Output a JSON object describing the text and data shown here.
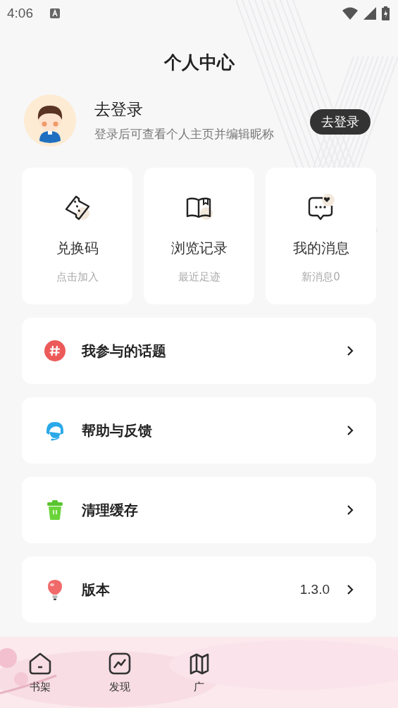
{
  "status_bar": {
    "time": "4:06"
  },
  "title": "个人中心",
  "profile": {
    "name": "去登录",
    "hint": "登录后可查看个人主页并编辑昵称",
    "login_button": "去登录"
  },
  "shortcuts": [
    {
      "kind": "ticket",
      "label": "兑换码",
      "caption": "点击加入"
    },
    {
      "kind": "book",
      "label": "浏览记录",
      "caption": "最近足迹"
    },
    {
      "kind": "message",
      "label": "我的消息",
      "caption": "新消息0"
    }
  ],
  "menu": [
    {
      "kind": "topic",
      "label": "我参与的话题"
    },
    {
      "kind": "help",
      "label": "帮助与反馈"
    },
    {
      "kind": "trash",
      "label": "清理缓存"
    },
    {
      "kind": "version",
      "label": "版本",
      "value": "1.3.0"
    }
  ],
  "tabs": [
    {
      "kind": "shelf",
      "label": "书架"
    },
    {
      "kind": "discover",
      "label": "发现"
    },
    {
      "kind": "map",
      "label": "广"
    }
  ]
}
